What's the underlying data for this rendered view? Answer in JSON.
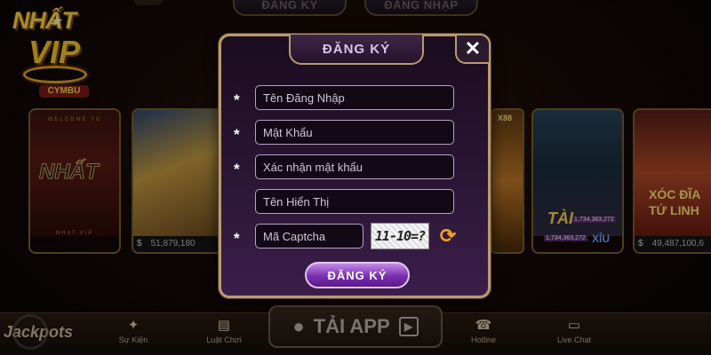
{
  "top_tabs": {
    "register": "ĐĂNG KÝ",
    "login": "ĐĂNG NHẬP"
  },
  "logo": {
    "line1": "NHẤT",
    "line2": "VIP",
    "badge": "CYMBU"
  },
  "cards": [
    {
      "name": "nhat-vip",
      "title": "NHẤT",
      "welcome": "WELCOME TO",
      "site": "NHAT.VIP",
      "balance": ""
    },
    {
      "name": "game-2",
      "balance": "51,879,180"
    },
    {
      "name": "game-partial",
      "label": "X88"
    },
    {
      "name": "tai-xiu",
      "title": "TÀI",
      "num1": "1,734,363,272",
      "num2": "1,734,363,272",
      "xiu": "XỈU",
      "balance": ""
    },
    {
      "name": "xoc-dia",
      "title": "XÓC ĐĨA TỨ LINH",
      "balance": "49,487,100,6"
    }
  ],
  "modal": {
    "title": "ĐĂNG KÝ",
    "close": "✕",
    "fields": {
      "username": "Tên Đăng Nhập",
      "password": "Mật Khẩu",
      "confirm": "Xác nhận mật khẩu",
      "display_name": "Tên Hiển Thị",
      "captcha": "Mã Captcha"
    },
    "required_mark": "*",
    "captcha_text": "11-10=?",
    "submit": "ĐĂNG KÝ"
  },
  "bottom": {
    "jackpots": "Jackpots",
    "tai_app": "TẢI APP",
    "nav": {
      "su_kien": "Sự Kiện",
      "luat_choi": "Luật Chơi",
      "hotline": "Hotline",
      "live_chat": "Live Chat"
    }
  },
  "colors": {
    "accent": "#b99a6e",
    "button": "#7a2fb0",
    "gold": "#f6c531"
  }
}
